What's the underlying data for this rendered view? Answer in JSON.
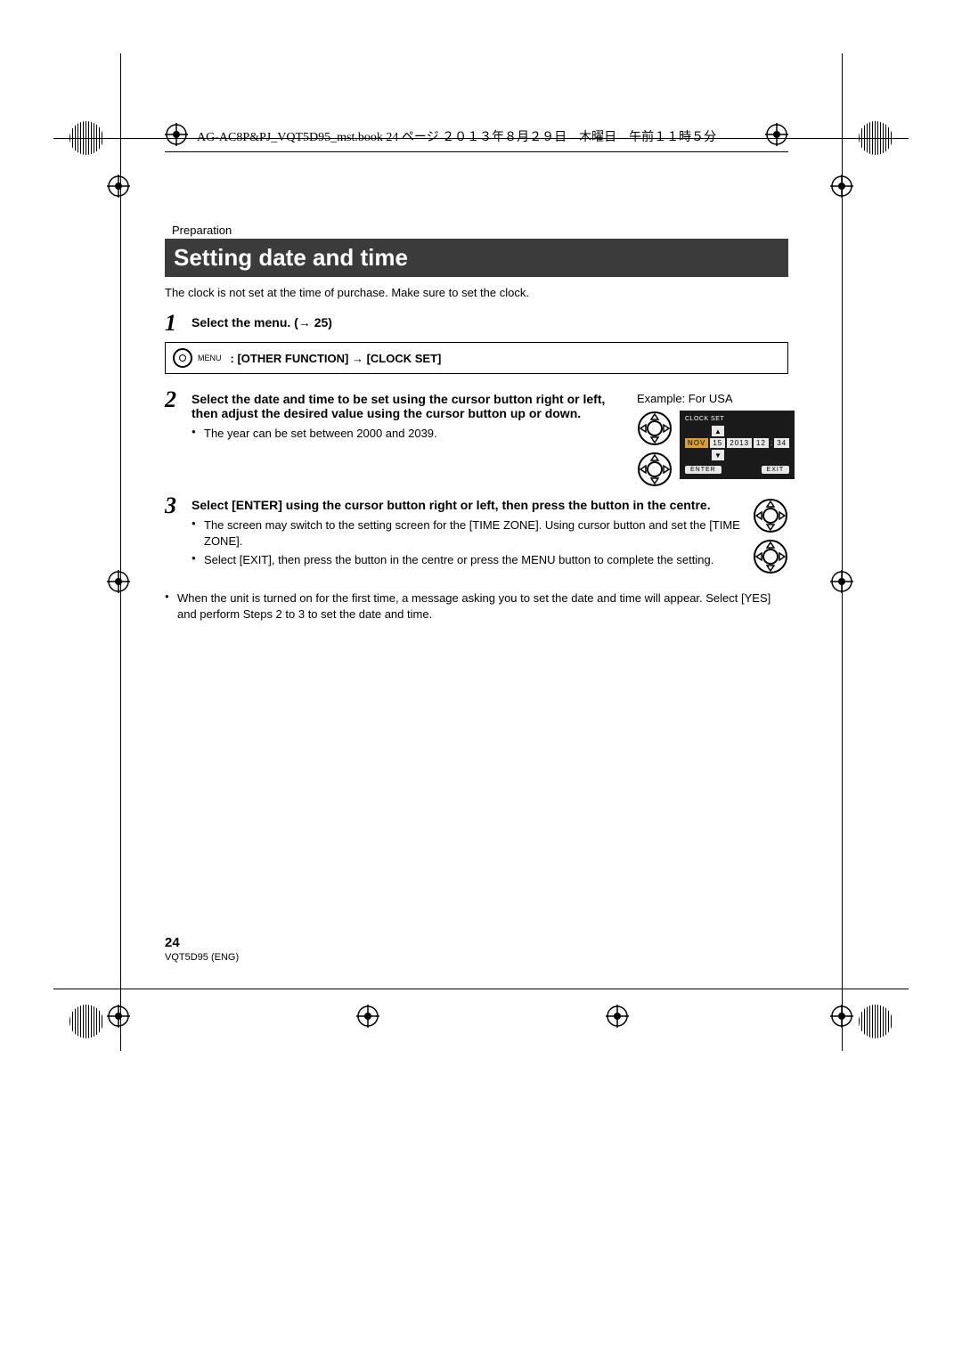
{
  "header_text": "AG-AC8P&PJ_VQT5D95_mst.book  24 ページ  ２０１３年８月２９日　木曜日　午前１１時５分",
  "section_label": "Preparation",
  "title": "Setting date and time",
  "intro": "The clock is not set at the time of purchase. Make sure to set the clock.",
  "step1": {
    "num": "1",
    "head": "Select the menu. (→ 25)",
    "menu_icon_label": "MENU",
    "menu_path": ": [OTHER FUNCTION] → [CLOCK SET]"
  },
  "step2": {
    "num": "2",
    "head": "Select the date and time to be set using the cursor button right or left, then adjust the desired value using the cursor button up or down.",
    "bullet1": "The year can be set between 2000 and 2039.",
    "example_label": "Example: For USA",
    "lcd": {
      "title": "CLOCK SET",
      "month": "NOV",
      "day": "15",
      "year": "2013",
      "hour": "12",
      "min": "34",
      "enter": "ENTER",
      "exit": "EXIT"
    }
  },
  "step3": {
    "num": "3",
    "head": "Select [ENTER] using the cursor button right or left, then press the button in the centre.",
    "bullet1": "The screen may switch to the setting screen for the [TIME ZONE]. Using cursor button and set the [TIME ZONE].",
    "bullet2": "Select [EXIT], then press the button in the centre or press the MENU button to complete the setting."
  },
  "note": "When the unit is turned on for the first time, a message asking you to set the date and time will appear. Select [YES] and perform Steps 2 to 3 to set the date and time.",
  "footer": {
    "page": "24",
    "code": "VQT5D95 (ENG)"
  }
}
